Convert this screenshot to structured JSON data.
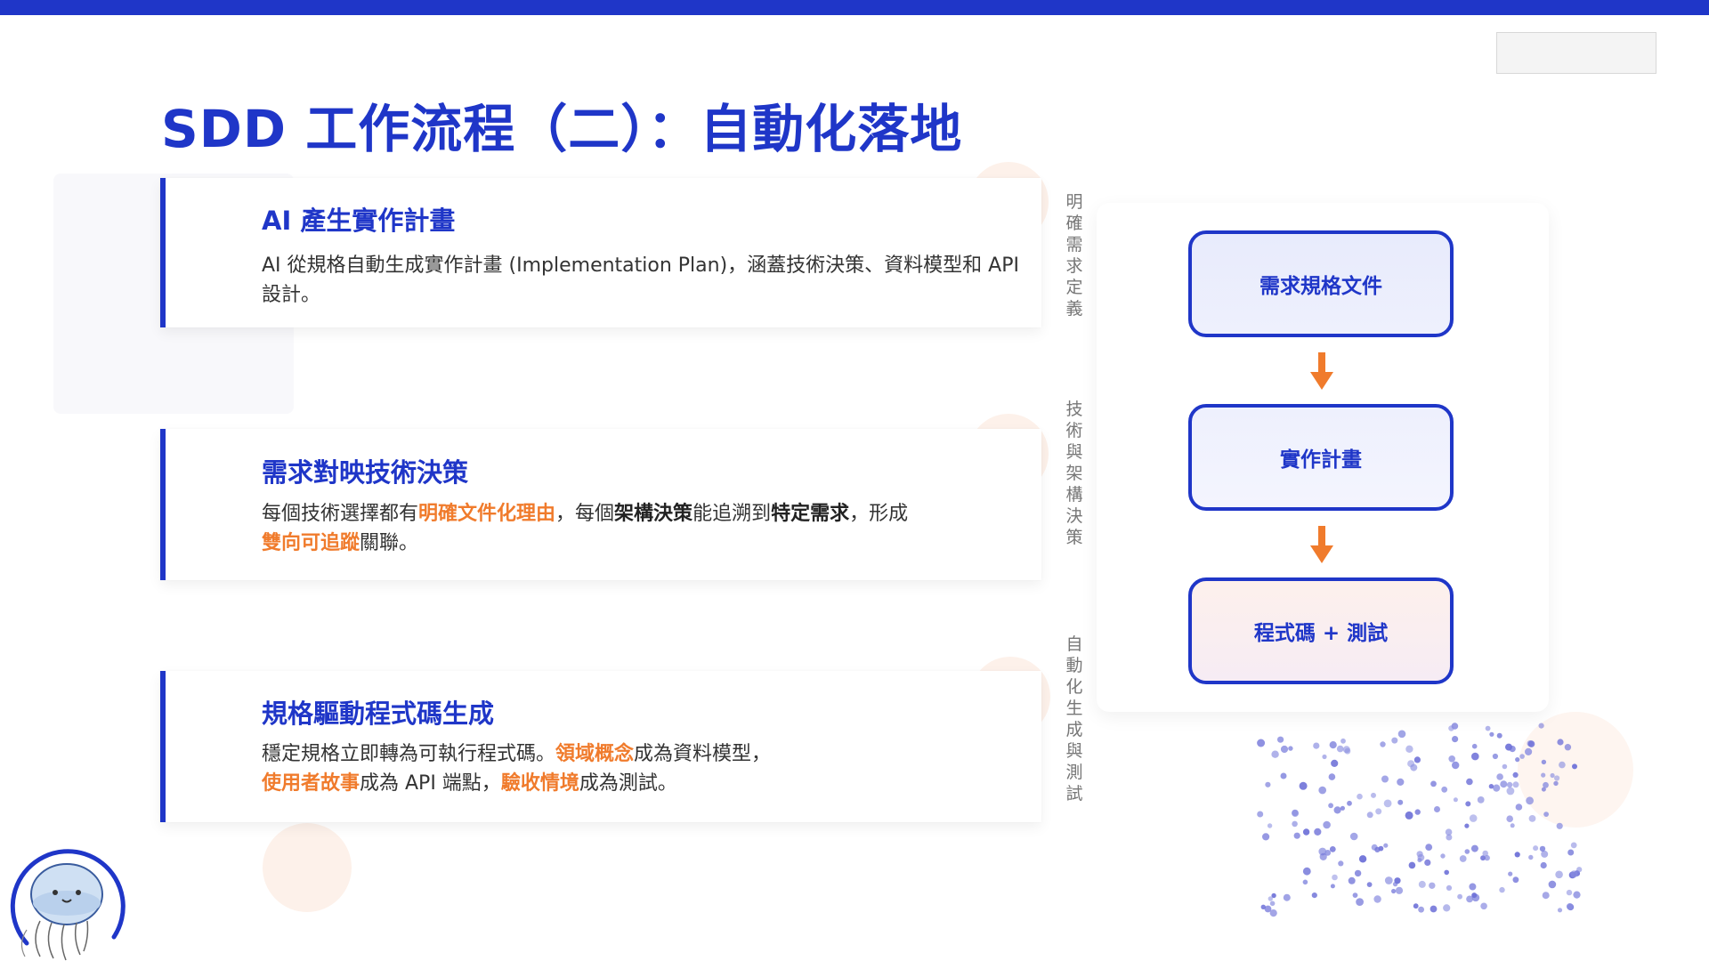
{
  "slide": {
    "title": "SDD 工作流程（二）：自動化落地"
  },
  "cards": [
    {
      "heading": "AI 產生實作計畫",
      "body": "AI 從規格自動生成實作計畫 (Implementation Plan)，涵蓋技術決策、資料模型和 API 設計。"
    },
    {
      "heading": "需求對映技術決策",
      "body_parts": [
        "每個技術選擇都有",
        "明確文件化理由",
        "，每個",
        "架構決策",
        "能追溯到",
        "特定需求",
        "，形成",
        "雙向可追蹤",
        "關聯。"
      ]
    },
    {
      "heading": "規格驅動程式碼生成",
      "body_parts": [
        "穩定規格立即轉為可執行程式碼。",
        "領域概念",
        "成為資料模型，",
        "使用者故事",
        "成為 API 端點，",
        "驗收情境",
        "成為測試。"
      ]
    }
  ],
  "side_labels": [
    [
      "明",
      "確",
      "需",
      "求",
      "定",
      "義"
    ],
    [
      "技",
      "術",
      "與",
      "架",
      "構",
      "決",
      "策"
    ],
    [
      "自",
      "動",
      "化",
      "生",
      "成",
      "與",
      "測",
      "試"
    ]
  ],
  "flow": {
    "steps": [
      "需求規格文件",
      "實作計畫",
      "程式碼 + 測試"
    ],
    "arrow_icon": "arrow-down-icon",
    "colors": {
      "primary": "#1f36c8",
      "accent": "#f07b2c"
    }
  }
}
